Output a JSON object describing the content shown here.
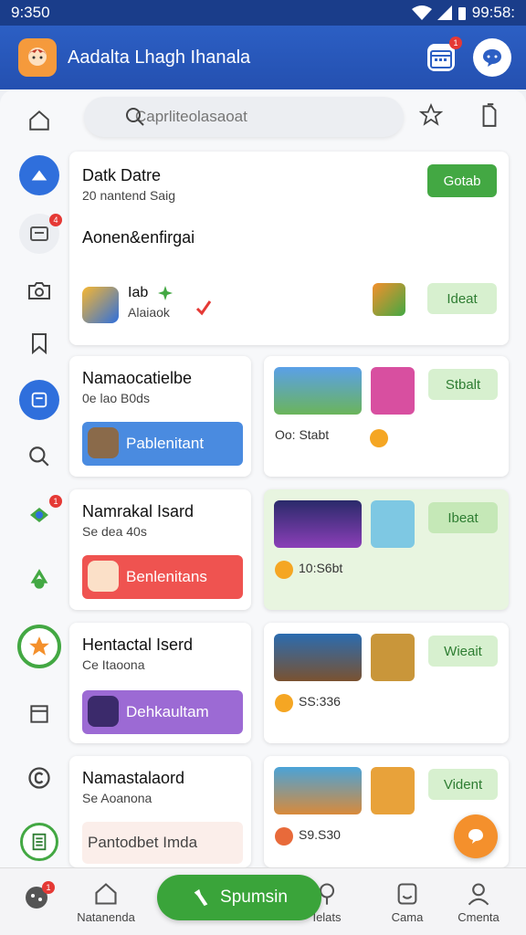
{
  "status_bar": {
    "time": "9:350",
    "right_time": "99:58:"
  },
  "app_bar": {
    "title": "Aadalta Lhagh Ihanala",
    "calendar_badge": "1"
  },
  "search": {
    "placeholder": "Caprliteolasaoat"
  },
  "sidebar": {
    "messages_badge": "4",
    "game_badge": "1"
  },
  "cards": {
    "featured": {
      "title": "Datk Datre",
      "subtitle": "20 nantend Saig",
      "section_title": "Aonen&enfirgai",
      "app_name": "Iab",
      "app_subtitle": "Alaiaok",
      "primary_button": "Gotab",
      "secondary_button": "Ideat"
    },
    "row1": {
      "title": "Namaocatielbe",
      "subtitle": "0e lao B0ds",
      "action_label": "Pablenitant",
      "price": "Oo: Stabt",
      "button": "Stbalt"
    },
    "row2": {
      "title": "Namrakal Isard",
      "subtitle": "Se dea 40s",
      "action_label": "Benlenitans",
      "price": "10:S6bt",
      "button": "Ibeat"
    },
    "row3": {
      "title": "Hentactal Iserd",
      "subtitle": "Ce Itaoona",
      "action_label": "Dehkaultam",
      "price": "SS:336",
      "button": "Wieait"
    },
    "row4": {
      "title": "Namastalaord",
      "subtitle": "Se Aoanona",
      "action_label": "Pantodbet Imda",
      "price": "S9.S30",
      "button": "Vident"
    }
  },
  "bottom_nav": {
    "items": [
      {
        "label": "",
        "badge": "1"
      },
      {
        "label": "Natanenda"
      },
      {
        "label": "Spumsin"
      },
      {
        "label": "Ielats"
      },
      {
        "label": "Cama"
      },
      {
        "label": "Cmenta"
      }
    ]
  },
  "colors": {
    "app_bar": "#2c5fc4",
    "accent_green": "#43a843",
    "light_green": "#d7f0cf",
    "blue_action": "#4a8be0",
    "red_action": "#ef5350",
    "purple_action": "#9c6ad4",
    "fab": "#f4902c"
  },
  "icons": [
    "home-icon",
    "messages-icon",
    "camera-icon",
    "bookmark-icon",
    "search-icon",
    "game-icon",
    "recycle-icon",
    "star-icon",
    "document-icon",
    "copyright-icon",
    "book-icon",
    "calendar-icon",
    "chat-icon",
    "clipboard-icon"
  ]
}
